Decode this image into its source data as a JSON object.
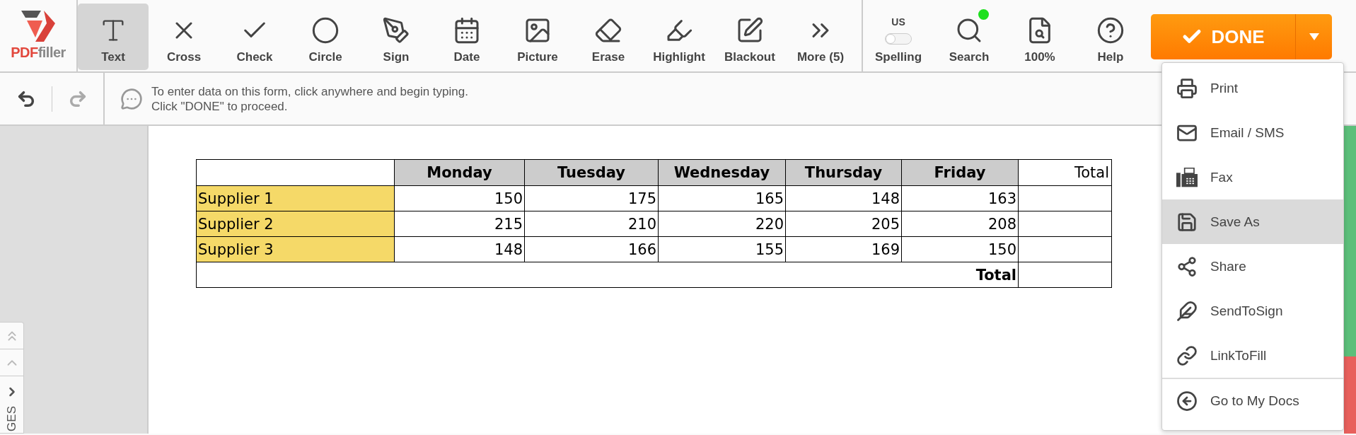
{
  "logo": {
    "part_a": "PDF",
    "part_b": "filler"
  },
  "tools": [
    {
      "label": "Text",
      "selected": true
    },
    {
      "label": "Cross",
      "selected": false
    },
    {
      "label": "Check",
      "selected": false
    },
    {
      "label": "Circle",
      "selected": false
    },
    {
      "label": "Sign",
      "selected": false
    },
    {
      "label": "Date",
      "selected": false
    },
    {
      "label": "Picture",
      "selected": false
    },
    {
      "label": "Erase",
      "selected": false
    },
    {
      "label": "Highlight",
      "selected": false
    },
    {
      "label": "Blackout",
      "selected": false
    },
    {
      "label": "More (5)",
      "selected": false
    }
  ],
  "spelling": {
    "language": "US",
    "label": "Spelling",
    "on": false
  },
  "search": {
    "label": "Search",
    "notification": true
  },
  "zoom": {
    "label": "100%"
  },
  "help": {
    "label": "Help"
  },
  "done_button": {
    "label": "DONE"
  },
  "undo": {
    "disabled": false
  },
  "redo": {
    "disabled": true
  },
  "hint": [
    "To enter data on this form, click anywhere and begin typing.",
    "Click \"DONE\" to proceed."
  ],
  "menu": [
    {
      "label": "Print",
      "selected": false,
      "divider_before": false
    },
    {
      "label": "Email / SMS",
      "selected": false,
      "divider_before": false
    },
    {
      "label": "Fax",
      "selected": false,
      "divider_before": false
    },
    {
      "label": "Save As",
      "selected": true,
      "divider_before": false
    },
    {
      "label": "Share",
      "selected": false,
      "divider_before": false
    },
    {
      "label": "SendToSign",
      "selected": false,
      "divider_before": false
    },
    {
      "label": "LinkToFill",
      "selected": false,
      "divider_before": false
    },
    {
      "label": "Go to My Docs",
      "selected": false,
      "divider_before": true
    }
  ],
  "table": {
    "columns": [
      {
        "label": "Monday",
        "shaded": true
      },
      {
        "label": "Tuesday",
        "shaded": true
      },
      {
        "label": "Wednesday",
        "shaded": true
      },
      {
        "label": "Thursday",
        "shaded": true
      },
      {
        "label": "Friday",
        "shaded": true
      },
      {
        "label": "Total",
        "shaded": false
      }
    ],
    "rows": [
      {
        "supplier": "Supplier 1",
        "values": [
          "150",
          "175",
          "165",
          "148",
          "163"
        ]
      },
      {
        "supplier": "Supplier 2",
        "values": [
          "215",
          "210",
          "220",
          "205",
          "208"
        ]
      },
      {
        "supplier": "Supplier 3",
        "values": [
          "148",
          "166",
          "155",
          "169",
          "150"
        ]
      }
    ],
    "footer": "Total"
  },
  "pages_panel": {
    "label": "GES"
  }
}
